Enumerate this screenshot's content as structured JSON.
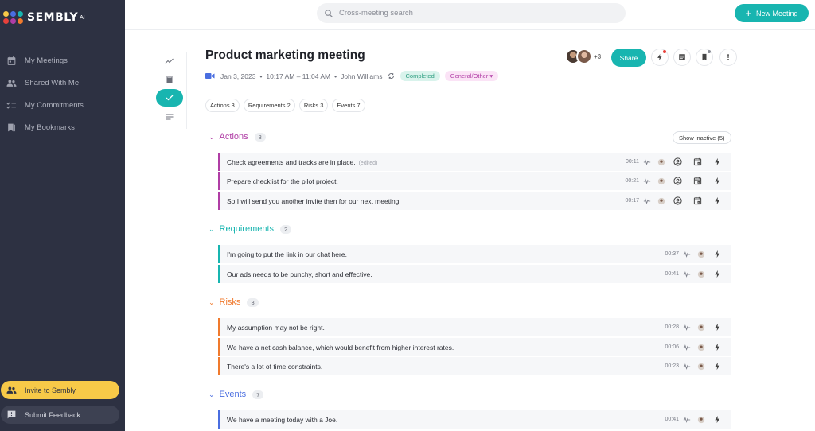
{
  "app": {
    "name": "SEMBLY",
    "suffix": "AI"
  },
  "sidebar": {
    "items": [
      {
        "label": "My Meetings",
        "icon": "calendar-icon"
      },
      {
        "label": "Shared With Me",
        "icon": "people-icon"
      },
      {
        "label": "My Commitments",
        "icon": "checklist-icon"
      },
      {
        "label": "My Bookmarks",
        "icon": "bookmarks-icon"
      }
    ],
    "invite_label": "Invite to Sembly",
    "feedback_label": "Submit Feedback"
  },
  "topbar": {
    "search_placeholder": "Cross-meeting search",
    "new_meeting_label": "New Meeting",
    "accent": "#18b5b0"
  },
  "meeting": {
    "title": "Product marketing meeting",
    "date": "Jan 3, 2023",
    "time": "10:17 AM – 11:04 AM",
    "owner": "John Williams",
    "status": "Completed",
    "category": "General/Other",
    "participants_more": "+3",
    "share_label": "Share"
  },
  "chips": [
    "Actions 3",
    "Requirements 2",
    "Risks 3",
    "Events 7"
  ],
  "show_inactive_label": "Show inactive (5)",
  "sections": {
    "actions": {
      "title": "Actions",
      "count": "3",
      "color": "#b03da5",
      "items": [
        {
          "text": "Check agreements and tracks are in place.",
          "edited": "(edited)",
          "time": "00:11"
        },
        {
          "text": "Prepare checklist for the pilot project.",
          "time": "00:21"
        },
        {
          "text": "So I will send you another invite then for our next meeting.",
          "time": "00:17"
        }
      ]
    },
    "requirements": {
      "title": "Requirements",
      "count": "2",
      "color": "#18b5b0",
      "items": [
        {
          "text": "I'm going to put the link in our chat here.",
          "time": "00:37"
        },
        {
          "text": "Our ads needs to be punchy, short and effective.",
          "time": "00:41"
        }
      ]
    },
    "risks": {
      "title": "Risks",
      "count": "3",
      "color": "#f07a2d",
      "items": [
        {
          "text": "My assumption may not be right.",
          "time": "00:28"
        },
        {
          "text": "We have a net cash balance, which would benefit from higher interest rates.",
          "time": "00:06"
        },
        {
          "text": "There's a lot of time constraints.",
          "time": "00:23"
        }
      ]
    },
    "events": {
      "title": "Events",
      "count": "7",
      "color": "#4a6ee0",
      "items": [
        {
          "text": "We have a meeting today with a Joe.",
          "time": "00:41"
        }
      ]
    }
  }
}
